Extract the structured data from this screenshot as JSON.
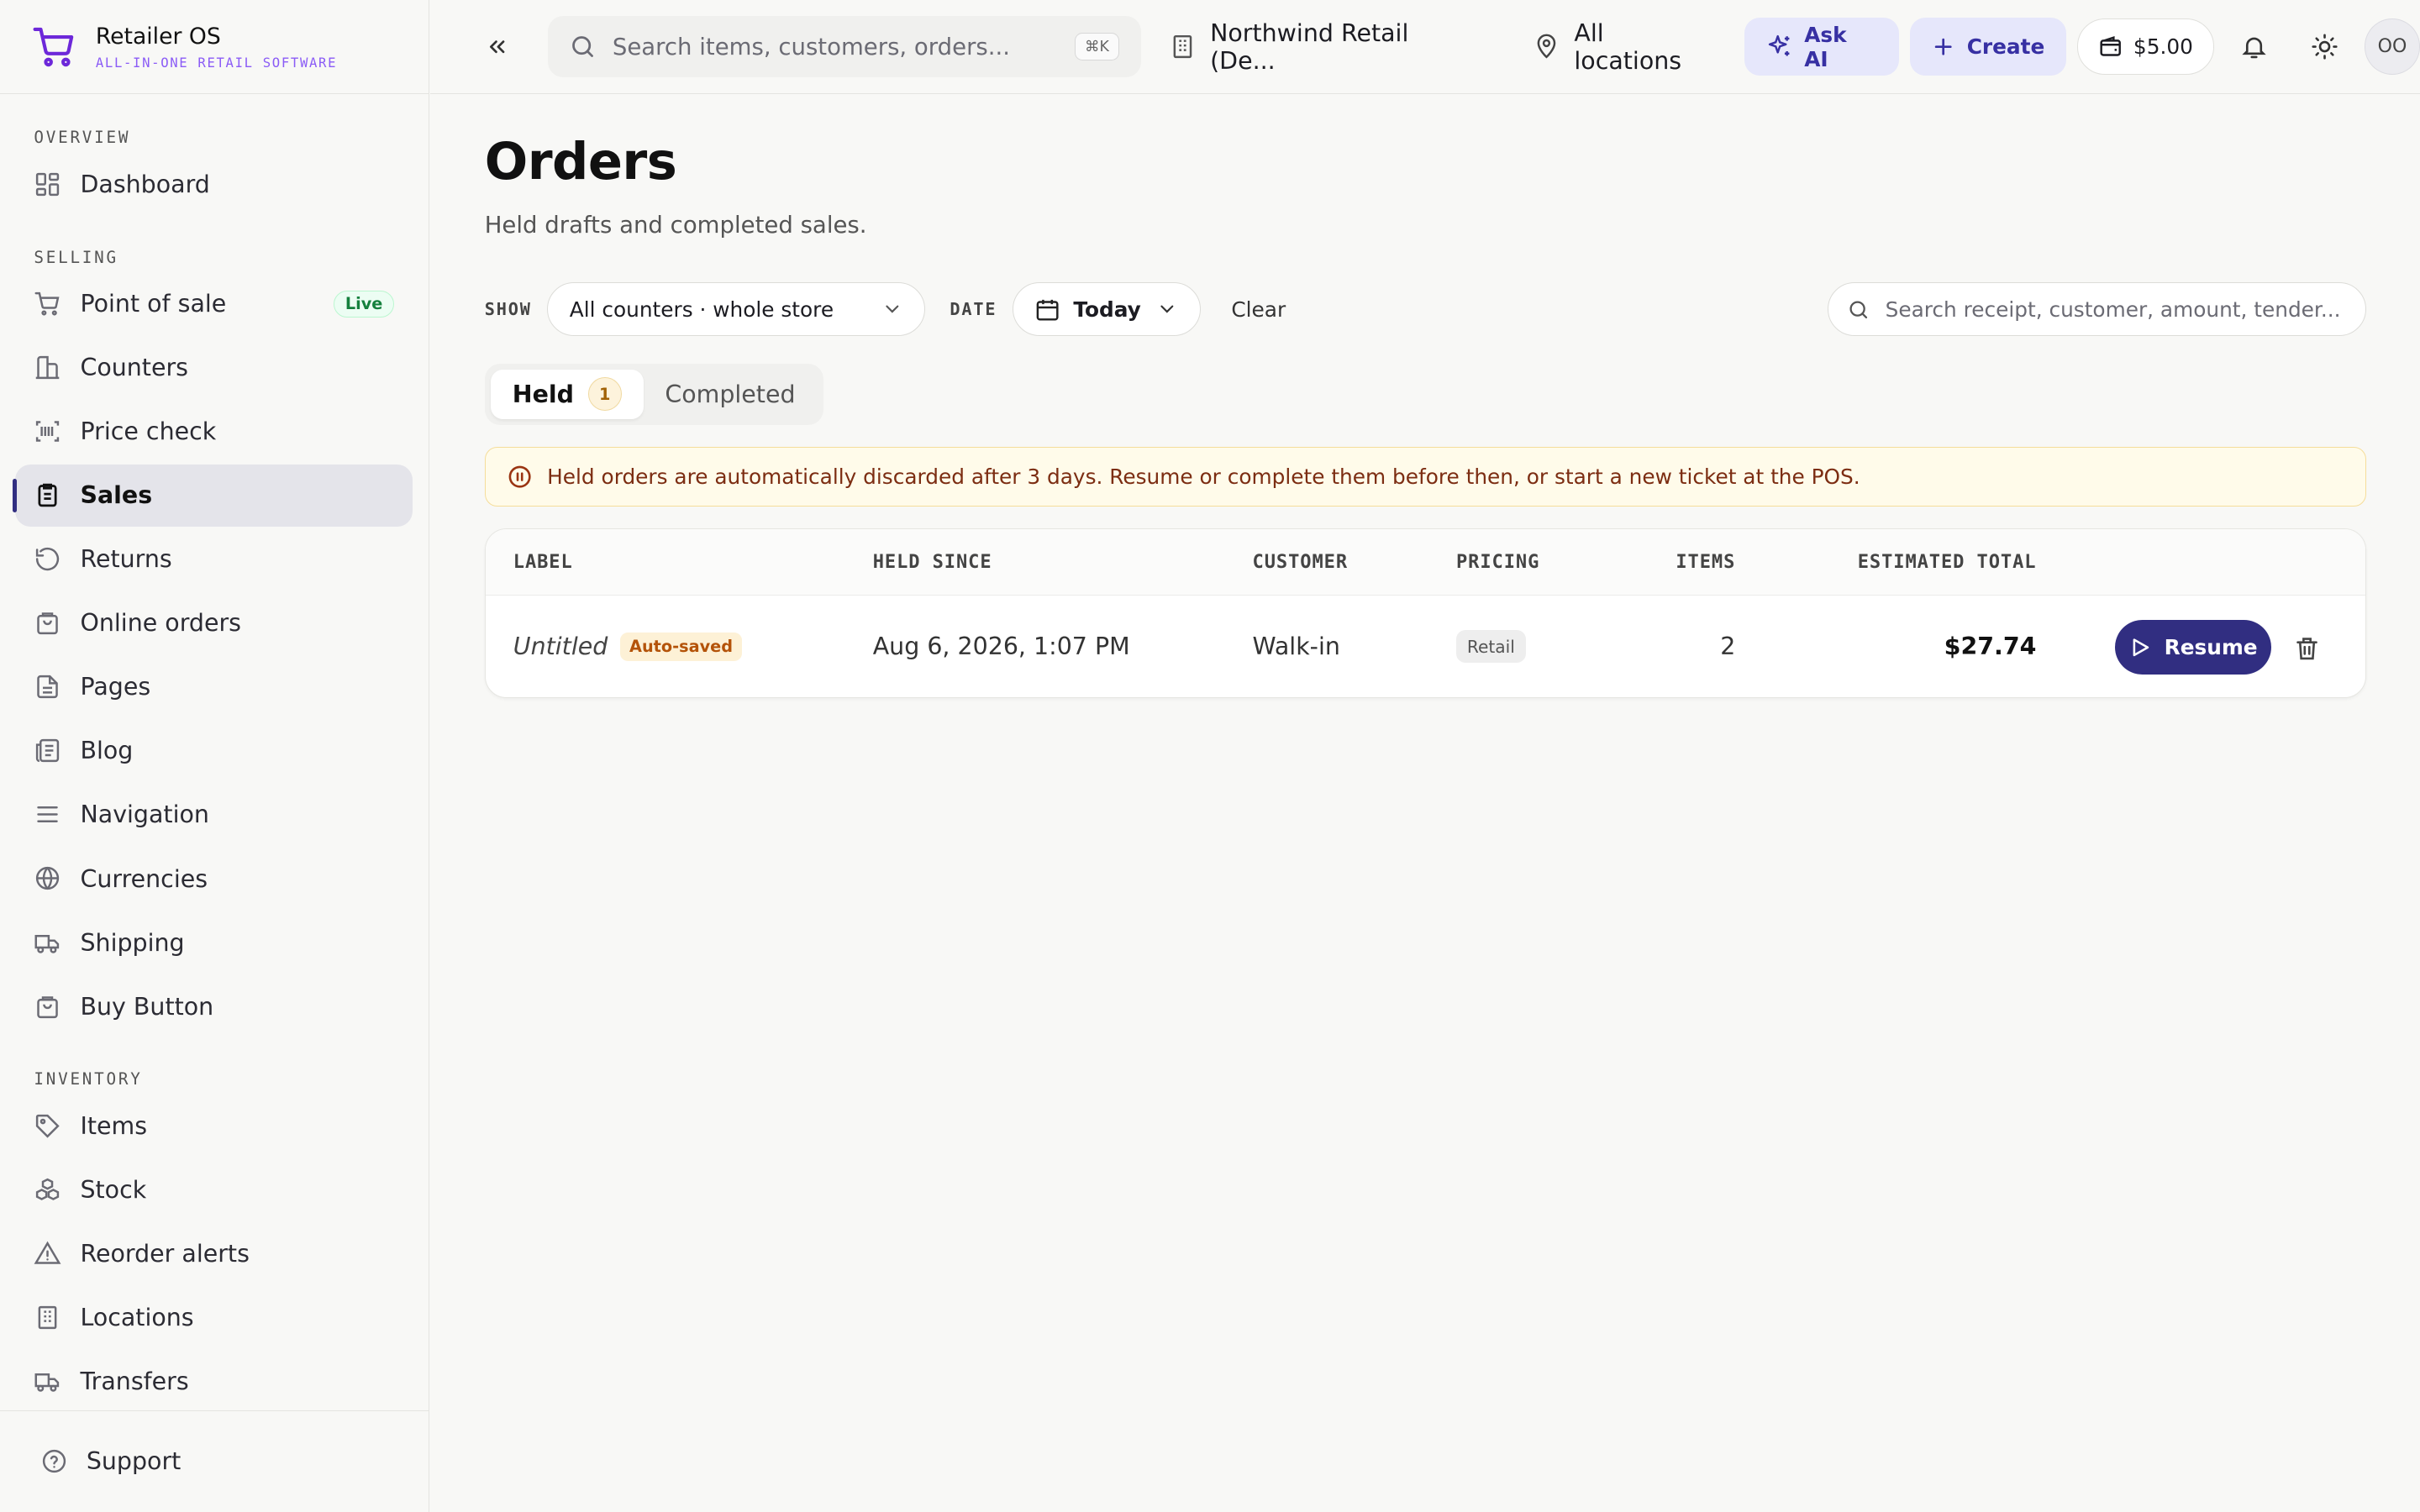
{
  "brand": {
    "name": "Retailer OS",
    "tagline": "ALL-IN-ONE RETAIL SOFTWARE",
    "accent": "#6d28d9"
  },
  "sidebar": {
    "sections": [
      {
        "title": "OVERVIEW",
        "items": [
          {
            "label": "Dashboard",
            "icon": "dashboard-icon"
          }
        ]
      },
      {
        "title": "SELLING",
        "items": [
          {
            "label": "Point of sale",
            "icon": "cart-icon",
            "badge": "Live"
          },
          {
            "label": "Counters",
            "icon": "counter-icon"
          },
          {
            "label": "Price check",
            "icon": "scan-icon"
          },
          {
            "label": "Sales",
            "icon": "clipboard-icon",
            "active": true
          },
          {
            "label": "Returns",
            "icon": "returns-icon"
          },
          {
            "label": "Online orders",
            "icon": "bag-icon"
          },
          {
            "label": "Pages",
            "icon": "page-icon"
          },
          {
            "label": "Blog",
            "icon": "blog-icon"
          },
          {
            "label": "Navigation",
            "icon": "menu-icon"
          },
          {
            "label": "Currencies",
            "icon": "globe-icon"
          },
          {
            "label": "Shipping",
            "icon": "truck-icon"
          },
          {
            "label": "Buy Button",
            "icon": "bag-icon"
          }
        ]
      },
      {
        "title": "INVENTORY",
        "items": [
          {
            "label": "Items",
            "icon": "tag-icon"
          },
          {
            "label": "Stock",
            "icon": "boxes-icon"
          },
          {
            "label": "Reorder alerts",
            "icon": "warning-icon"
          },
          {
            "label": "Locations",
            "icon": "building-icon"
          },
          {
            "label": "Transfers",
            "icon": "truck-icon"
          }
        ]
      }
    ],
    "support_label": "Support"
  },
  "topbar": {
    "search_placeholder": "Search items, customers, orders...",
    "search_shortcut": "⌘K",
    "store": "Northwind Retail (De...",
    "location": "All locations",
    "ask_ai": "Ask AI",
    "create": "Create",
    "wallet": "$5.00",
    "avatar_initials": "OO"
  },
  "page": {
    "title": "Orders",
    "subtitle": "Held drafts and completed sales.",
    "filters": {
      "show_label": "SHOW",
      "show_value": "All counters · whole store",
      "date_label": "DATE",
      "date_value": "Today",
      "clear": "Clear",
      "search_placeholder": "Search receipt, customer, amount, tender..."
    },
    "tabs": [
      {
        "label": "Held",
        "count": "1",
        "active": true
      },
      {
        "label": "Completed"
      }
    ],
    "alert": "Held orders are automatically discarded after 3 days. Resume or complete them before then, or start a new ticket at the POS.",
    "table": {
      "columns": [
        "LABEL",
        "HELD SINCE",
        "CUSTOMER",
        "PRICING",
        "ITEMS",
        "ESTIMATED TOTAL"
      ],
      "rows": [
        {
          "label": "Untitled",
          "label_badge": "Auto-saved",
          "held_since": "Aug 6, 2026, 1:07 PM",
          "customer": "Walk-in",
          "pricing": "Retail",
          "items": "2",
          "total": "$27.74",
          "action": "Resume"
        }
      ]
    }
  }
}
